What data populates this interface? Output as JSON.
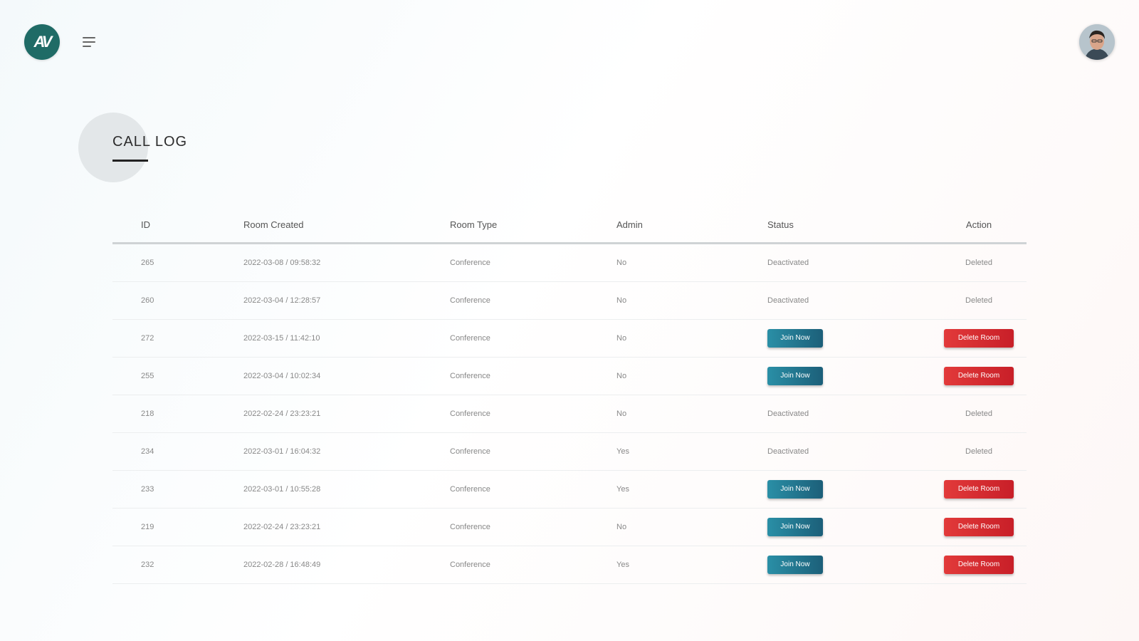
{
  "header": {
    "logo_text": "AV",
    "logo_color": "#1f6b66",
    "menu_icon": "hamburger-menu-icon",
    "avatar_icon": "user-avatar"
  },
  "page": {
    "title": "CALL LOG"
  },
  "table": {
    "columns": {
      "id": "ID",
      "room_created": "Room Created",
      "room_type": "Room Type",
      "admin": "Admin",
      "status": "Status",
      "action": "Action"
    },
    "join_label": "Join Now",
    "delete_label": "Delete Room",
    "join_color": "#1f7f97",
    "delete_color": "#d72b31",
    "rows": [
      {
        "id": "265",
        "created": "2022-03-08 / 09:58:32",
        "type": "Conference",
        "admin": "No",
        "status": "Deactivated",
        "action": "Deleted",
        "active": false
      },
      {
        "id": "260",
        "created": "2022-03-04 / 12:28:57",
        "type": "Conference",
        "admin": "No",
        "status": "Deactivated",
        "action": "Deleted",
        "active": false
      },
      {
        "id": "272",
        "created": "2022-03-15 / 11:42:10",
        "type": "Conference",
        "admin": "No",
        "status": "",
        "action": "",
        "active": true
      },
      {
        "id": "255",
        "created": "2022-03-04 / 10:02:34",
        "type": "Conference",
        "admin": "No",
        "status": "",
        "action": "",
        "active": true
      },
      {
        "id": "218",
        "created": "2022-02-24 / 23:23:21",
        "type": "Conference",
        "admin": "No",
        "status": "Deactivated",
        "action": "Deleted",
        "active": false
      },
      {
        "id": "234",
        "created": "2022-03-01 / 16:04:32",
        "type": "Conference",
        "admin": "Yes",
        "status": "Deactivated",
        "action": "Deleted",
        "active": false
      },
      {
        "id": "233",
        "created": "2022-03-01 / 10:55:28",
        "type": "Conference",
        "admin": "Yes",
        "status": "",
        "action": "",
        "active": true
      },
      {
        "id": "219",
        "created": "2022-02-24 / 23:23:21",
        "type": "Conference",
        "admin": "No",
        "status": "",
        "action": "",
        "active": true
      },
      {
        "id": "232",
        "created": "2022-02-28 / 16:48:49",
        "type": "Conference",
        "admin": "Yes",
        "status": "",
        "action": "",
        "active": true
      }
    ]
  }
}
